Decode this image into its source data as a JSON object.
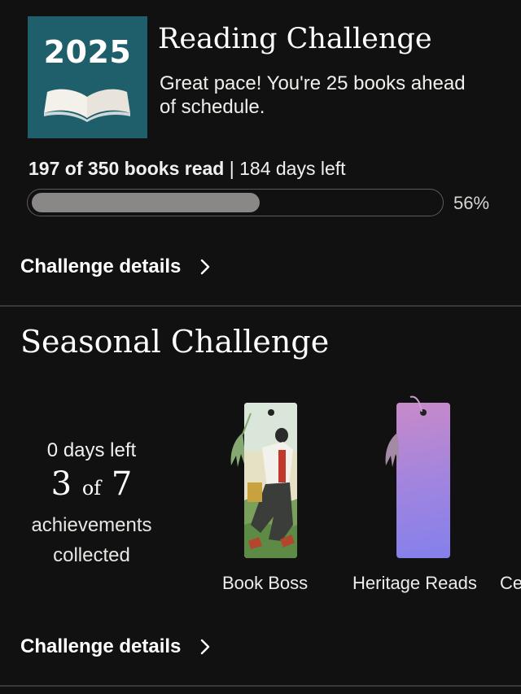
{
  "reading_challenge": {
    "badge_year": "2025",
    "title": "Reading Challenge",
    "subtitle": "Great pace! You're 25 books ahead of schedule.",
    "books_read": "197 of 350 books read",
    "separator": " | ",
    "days_left": "184 days left",
    "progress_fraction": 0.56,
    "progress_label": "56%",
    "details_label": "Challenge details"
  },
  "seasonal_challenge": {
    "title": "Seasonal Challenge",
    "days_left": "0 days left",
    "count_done": "3",
    "count_of": "of",
    "count_total": "7",
    "achievements_label_line1": "achievements",
    "achievements_label_line2": "collected",
    "bookmarks": [
      {
        "label": "Book Boss",
        "icon": "bookmark-reader-illustration"
      },
      {
        "label": "Heritage Reads",
        "icon": "bookmark-gradient"
      },
      {
        "label": "Ce",
        "icon": "bookmark-partial"
      }
    ],
    "details_label": "Challenge details"
  },
  "colors": {
    "background": "#121112",
    "badge": "#1f5e6b",
    "progress_fill": "#8a8887"
  }
}
